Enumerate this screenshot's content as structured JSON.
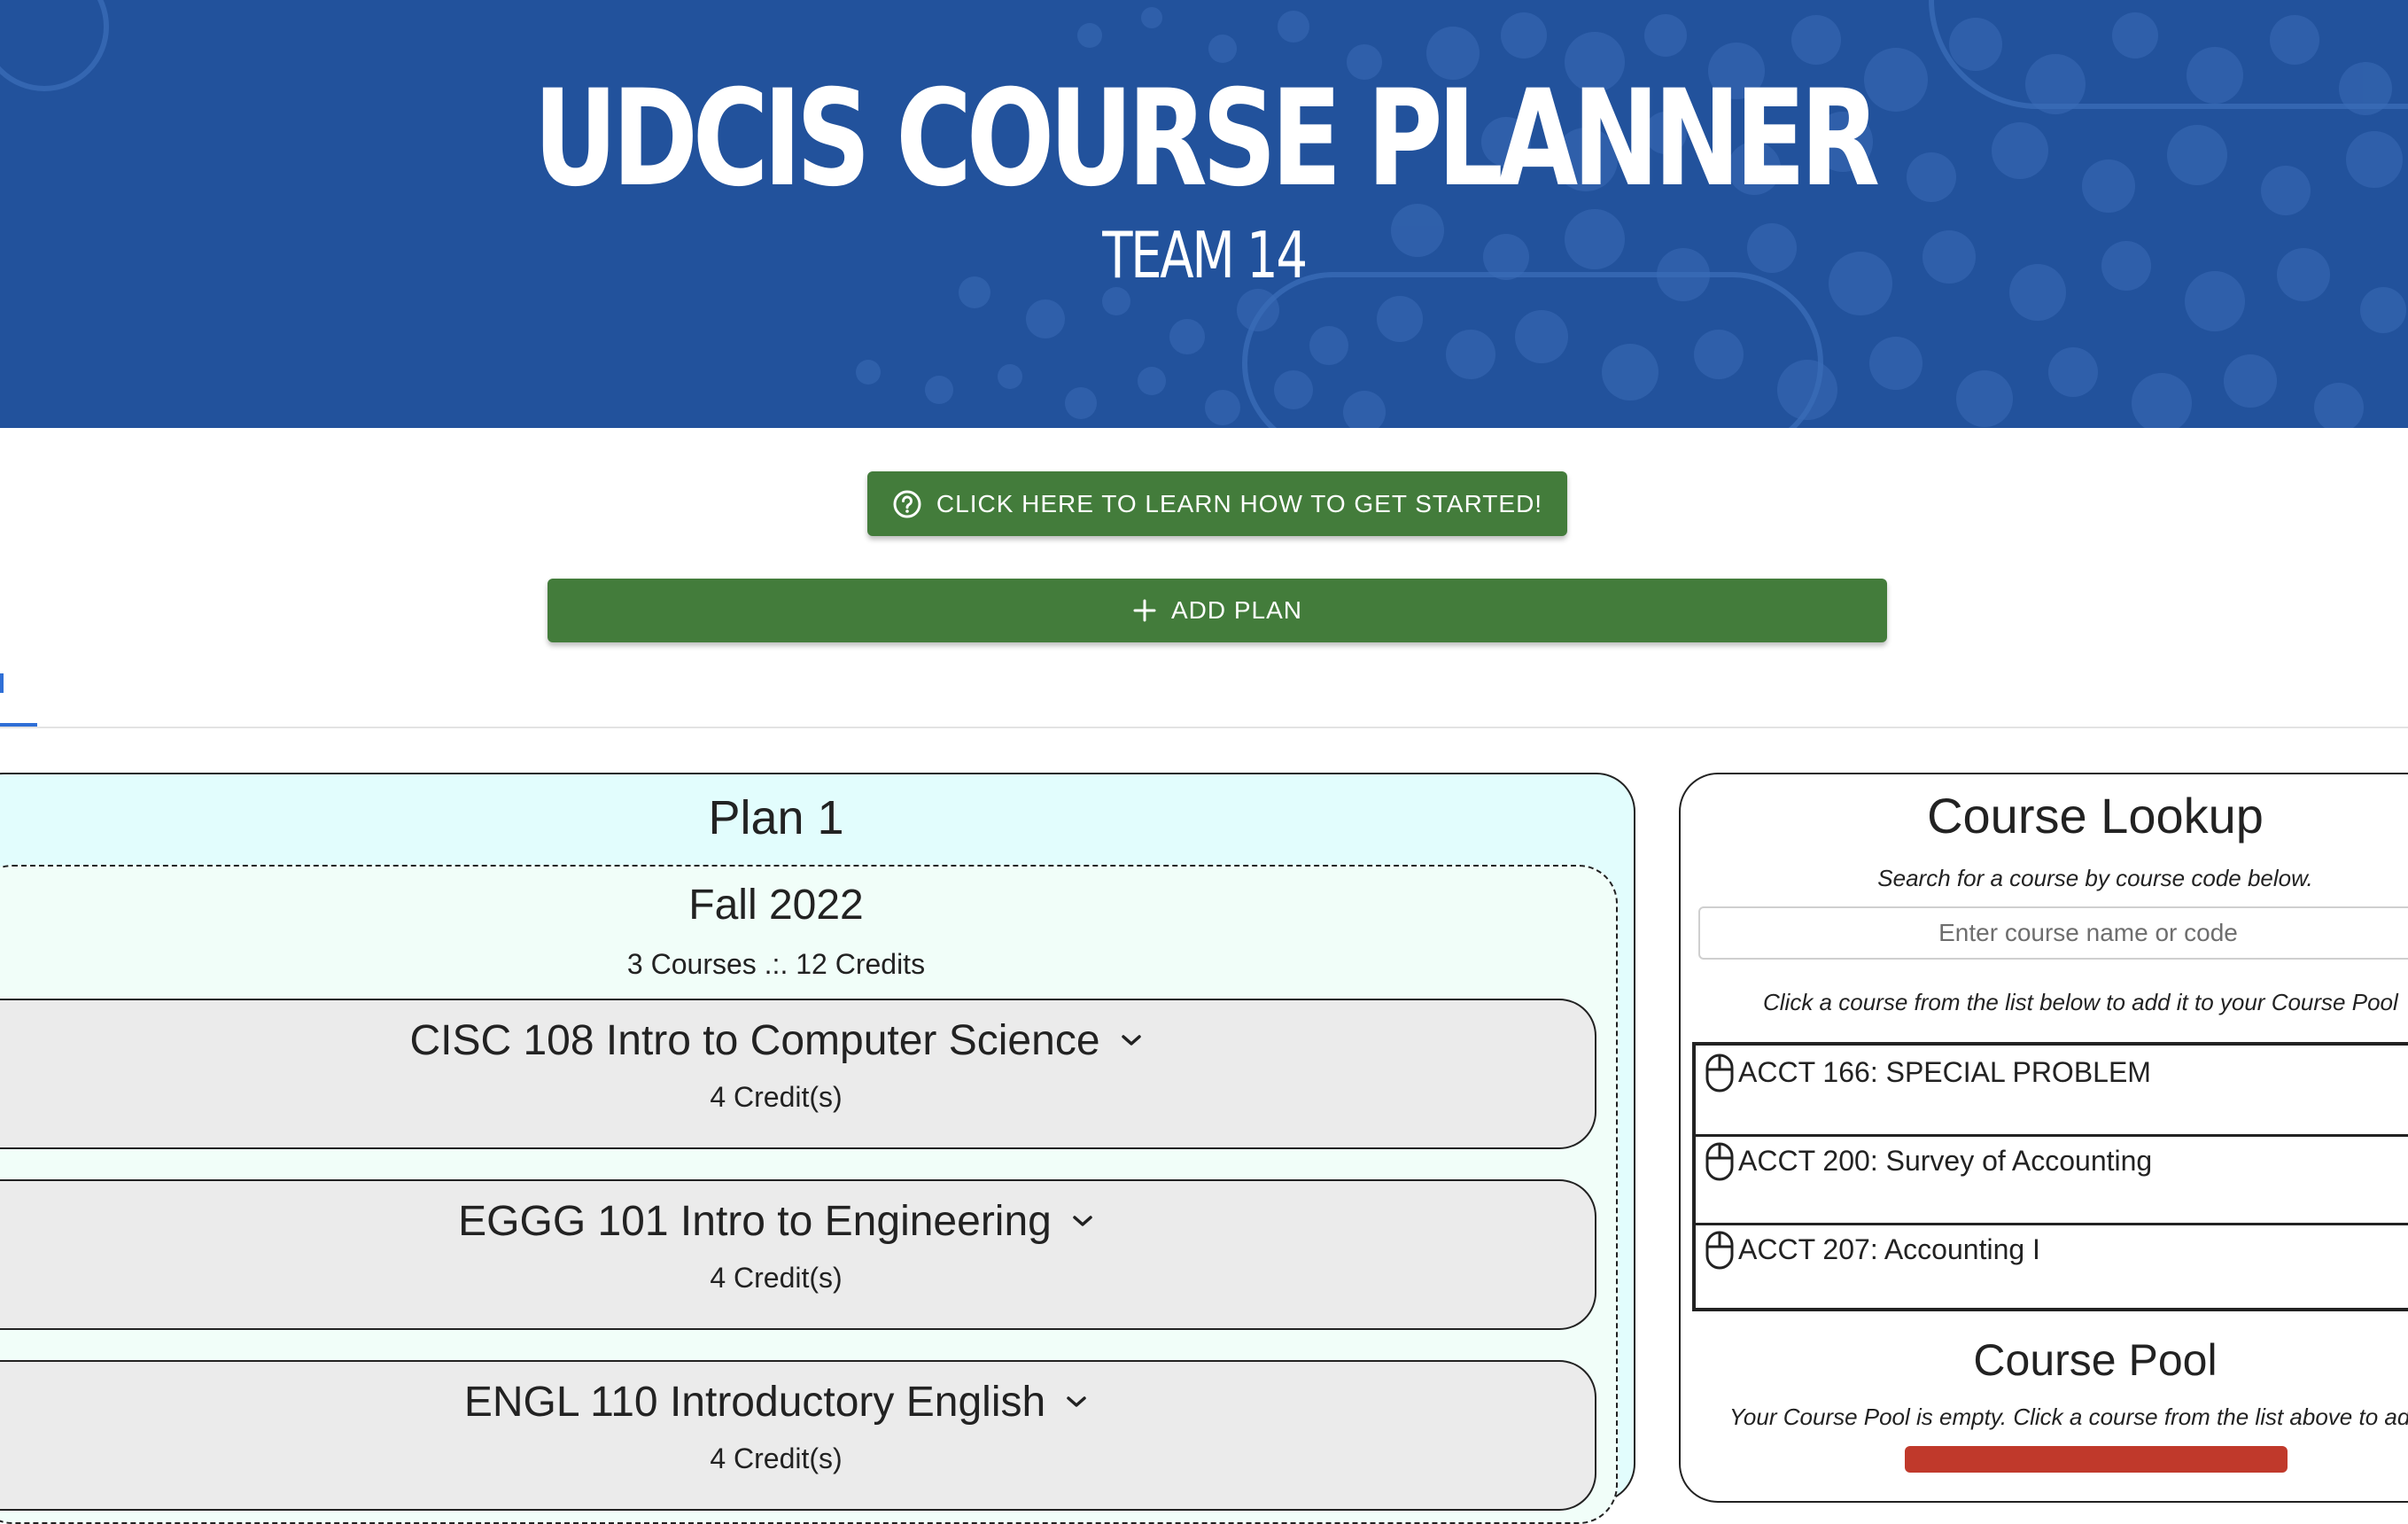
{
  "header": {
    "title": "UDCIS COURSE PLANNER",
    "subtitle": "TEAM 14"
  },
  "actions": {
    "help_label": "CLICK HERE TO LEARN HOW TO GET STARTED!",
    "help_icon": "help-circle-icon",
    "add_plan_label": "ADD PLAN",
    "add_plan_icon": "plus-icon"
  },
  "plan": {
    "title": "Plan 1",
    "semester": {
      "title": "Fall 2022",
      "summary": "3 Courses .:. 12 Credits",
      "courses": [
        {
          "title": "CISC 108 Intro to Computer Science",
          "credits": "4 Credit(s)"
        },
        {
          "title": "EGGG 101 Intro to Engineering",
          "credits": "4 Credit(s)"
        },
        {
          "title": "ENGL 110 Introductory English",
          "credits": "4 Credit(s)"
        }
      ]
    }
  },
  "lookup": {
    "title": "Course Lookup",
    "subtitle": "Search for a course by course code below.",
    "placeholder": "Enter course name or code",
    "hint": "Click a course from the list below to add it to your Course Pool",
    "results": [
      "ACCT 166: SPECIAL PROBLEM",
      "ACCT 200: Survey of Accounting",
      "ACCT 207: Accounting I"
    ]
  },
  "pool": {
    "title": "Course Pool",
    "empty_text": "Your Course Pool is empty. Click a course from the list above to add it."
  },
  "colors": {
    "banner": "#22529c",
    "button_green": "#437c3b",
    "plan_bg": "#e2fdfd",
    "card_bg": "#ebebeb",
    "tab_accent": "#2f6fd6",
    "pool_button": "#c0392b"
  }
}
